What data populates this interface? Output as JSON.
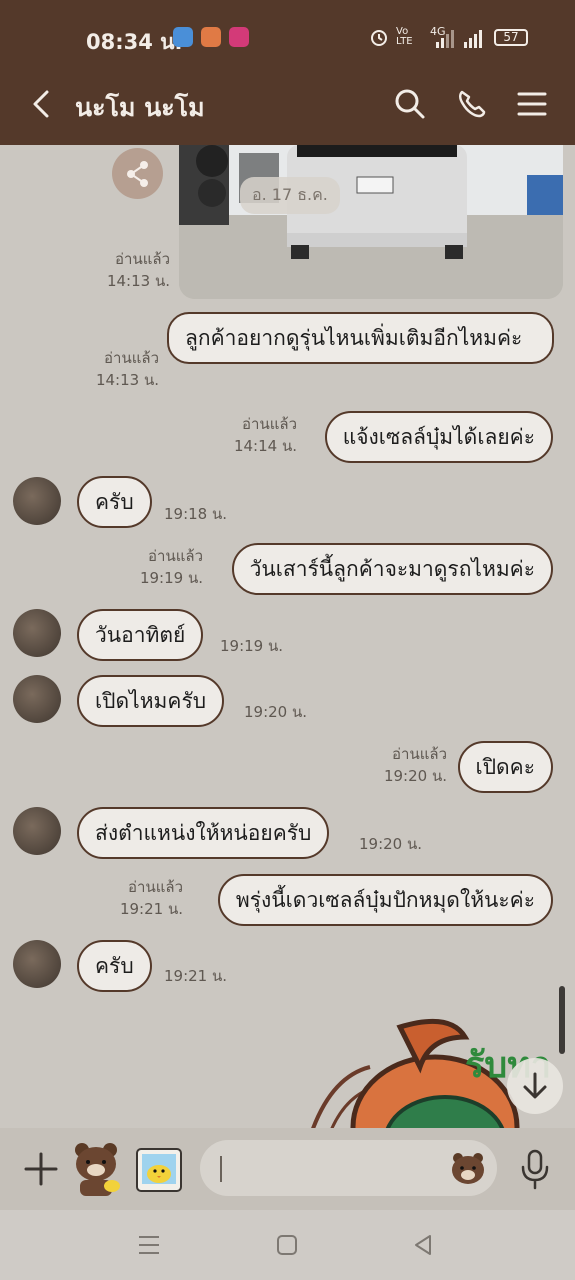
{
  "status_bar": {
    "time": "08:34 น.",
    "network": "Vo LTE",
    "signal_type": "4G",
    "battery": "57"
  },
  "header": {
    "title": "นะโม นะโม"
  },
  "photo": {
    "date_chip": "อ. 17 ธ.ค."
  },
  "messages": [
    {
      "side": "right",
      "read": "อ่านแล้ว",
      "time": "14:13 น."
    },
    {
      "side": "right",
      "text": "ลูกค้าอยากดูรุ่นไหนเพิ่มเติมอีกไหมค่ะ",
      "read": "อ่านแล้ว",
      "time": "14:13 น."
    },
    {
      "side": "right",
      "text": "แจ้งเซลล์บุ๋มได้เลยค่ะ",
      "read": "อ่านแล้ว",
      "time": "14:14 น."
    },
    {
      "side": "left",
      "text": "ครับ",
      "time": "19:18 น."
    },
    {
      "side": "right",
      "text": "วันเสาร์นี้ลูกค้าจะมาดูรถไหมค่ะ",
      "read": "อ่านแล้ว",
      "time": "19:19 น."
    },
    {
      "side": "left",
      "text": "วันอาทิตย์",
      "time": "19:19 น."
    },
    {
      "side": "left",
      "text": "เปิดไหมครับ",
      "time": "19:20 น."
    },
    {
      "side": "right",
      "text": "เปิดคะ",
      "read": "อ่านแล้ว",
      "time": "19:20 น."
    },
    {
      "side": "left",
      "text": "ส่งตำแหน่งให้หน่อยครับ",
      "time": "19:20 น."
    },
    {
      "side": "right",
      "text": "พรุ่งนี้เดวเซลล์บุ๋มปักหมุดให้นะค่ะ",
      "read": "อ่านแล้ว",
      "time": "19:21 น."
    },
    {
      "side": "left",
      "text": "ครับ",
      "time": "19:21 น."
    }
  ],
  "colors": {
    "header_bg": "#54392a",
    "chat_bg": "#cbc7c1",
    "bubble_bg": "#eeebe7",
    "bubble_border": "#54392a"
  },
  "icons": [
    "back-arrow-icon",
    "search-icon",
    "phone-icon",
    "menu-icon",
    "share-icon",
    "plus-icon",
    "brown-bear-sticker-icon",
    "gallery-icon",
    "emoji-bear-icon",
    "microphone-icon",
    "scroll-down-icon"
  ]
}
